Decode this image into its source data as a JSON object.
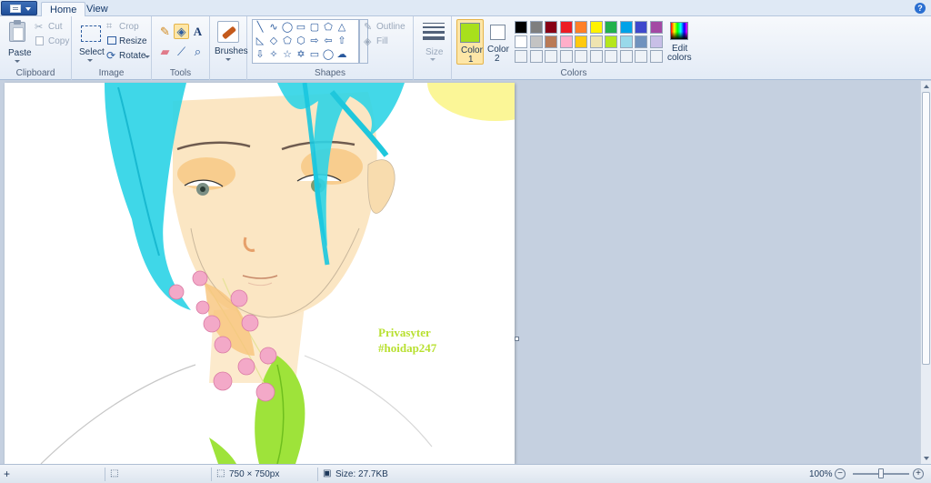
{
  "tabs": {
    "home": "Home",
    "view": "View"
  },
  "clipboard": {
    "paste": "Paste",
    "cut": "Cut",
    "copy": "Copy",
    "label": "Clipboard"
  },
  "image": {
    "select": "Select",
    "crop": "Crop",
    "resize": "Resize",
    "rotate": "Rotate",
    "label": "Image"
  },
  "tools": {
    "label": "Tools",
    "text_tool": "A"
  },
  "brushes": {
    "label": "Brushes"
  },
  "shapes": {
    "label": "Shapes",
    "outline": "Outline",
    "fill": "Fill"
  },
  "size": {
    "label": "Size"
  },
  "colors": {
    "color1_label": "Color",
    "color1_num": "1",
    "color2_label": "Color",
    "color2_num": "2",
    "edit_label": "Edit",
    "edit_label2": "colors",
    "label": "Colors",
    "color1_value": "#a8e01c",
    "color2_value": "#ffffff",
    "palette_row1": [
      "#000000",
      "#7f7f7f",
      "#880015",
      "#ed1c24",
      "#ff7f27",
      "#fff200",
      "#22b14c",
      "#00a2e8",
      "#3f48cc",
      "#a349a4"
    ],
    "palette_row2": [
      "#ffffff",
      "#c3c3c3",
      "#b97a57",
      "#ffaec9",
      "#ffc90e",
      "#efe4b0",
      "#b5e61d",
      "#99d9ea",
      "#7092be",
      "#c8bfe7"
    ]
  },
  "canvas": {
    "watermark_line1": "Privasyter",
    "watermark_line2": "#hoidap247"
  },
  "status": {
    "dimensions": "750 × 750px",
    "size": "Size: 27.7KB",
    "zoom": "100%"
  }
}
